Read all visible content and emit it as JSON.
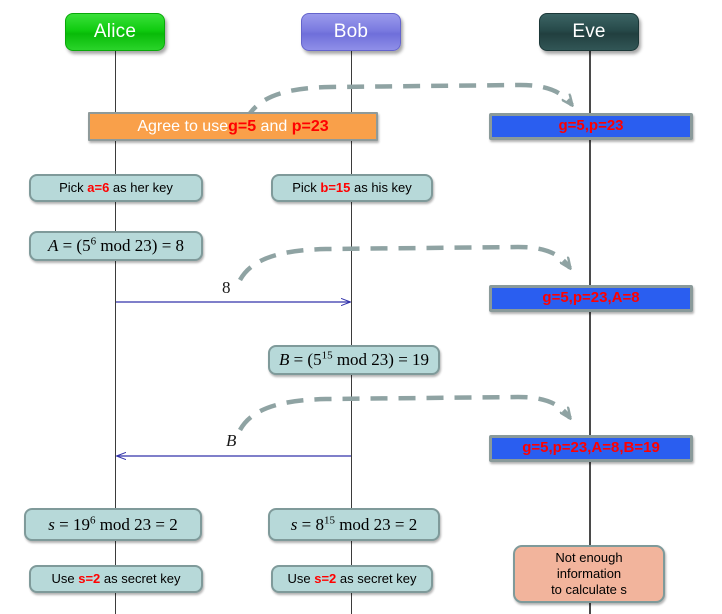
{
  "diagram": {
    "title": "Diffie-Hellman key exchange sequence diagram",
    "colors": {
      "alice": "#10cc10",
      "bob": "#7b7be0",
      "eve": "#274a4a",
      "agree_box": "#f9a04a",
      "eve_knowledge_box": "#2a5ef0",
      "note_box": "#b7d9d9",
      "not_enough_box": "#f2b49c",
      "solid_arrow": "#3333aa",
      "dashed_arrow": "#8fa3a3",
      "red_highlight": "#ff0000"
    }
  },
  "actors": [
    {
      "name": "alice",
      "label": "Alice"
    },
    {
      "name": "bob",
      "label": "Bob"
    },
    {
      "name": "eve",
      "label": "Eve"
    }
  ],
  "agree_step": {
    "prefix": "Agree to use ",
    "g": "g=5",
    "middle": " and ",
    "p": "p=23"
  },
  "eve_knowledge": [
    {
      "text": "g=5,p=23"
    },
    {
      "text": "g=5,p=23,A=8"
    },
    {
      "text": "g=5,p=23,A=8,B=19"
    }
  ],
  "alice_steps": {
    "pick_prefix": "Pick ",
    "pick_key": "a=6",
    "pick_suffix": " as her key",
    "compute": {
      "lhs": "A",
      "eq": " = (5",
      "exp": "6",
      "mod": " mod 23) = 8"
    },
    "secret": {
      "lhs": "s",
      "eq": " = 19",
      "exp": "6",
      "mod": " mod 23 = 2"
    },
    "use_prefix": "Use ",
    "use_key": "s=2",
    "use_suffix": " as secret key"
  },
  "bob_steps": {
    "pick_prefix": "Pick ",
    "pick_key": "b=15",
    "pick_suffix": " as his key",
    "compute": {
      "lhs": "B",
      "eq": " = (5",
      "exp": "15",
      "mod": " mod 23) = 19"
    },
    "secret": {
      "lhs": "s",
      "eq": " = 8",
      "exp": "15",
      "mod": " mod 23 = 2"
    },
    "use_prefix": "Use ",
    "use_key": "s=2",
    "use_suffix": " as secret key"
  },
  "eve_steps": {
    "not_enough_line1": "Not enough",
    "not_enough_line2": "information",
    "not_enough_line3": "to calculate s"
  },
  "messages": [
    {
      "name": "alice-to-bob-A",
      "label": "8",
      "from": "alice",
      "to": "bob",
      "direction": "right"
    },
    {
      "name": "bob-to-alice-B",
      "label": "B",
      "from": "bob",
      "to": "alice",
      "direction": "left"
    }
  ],
  "intercepts": [
    {
      "name": "intercept-params",
      "to": "eve"
    },
    {
      "name": "intercept-A",
      "to": "eve"
    },
    {
      "name": "intercept-B",
      "to": "eve"
    }
  ]
}
